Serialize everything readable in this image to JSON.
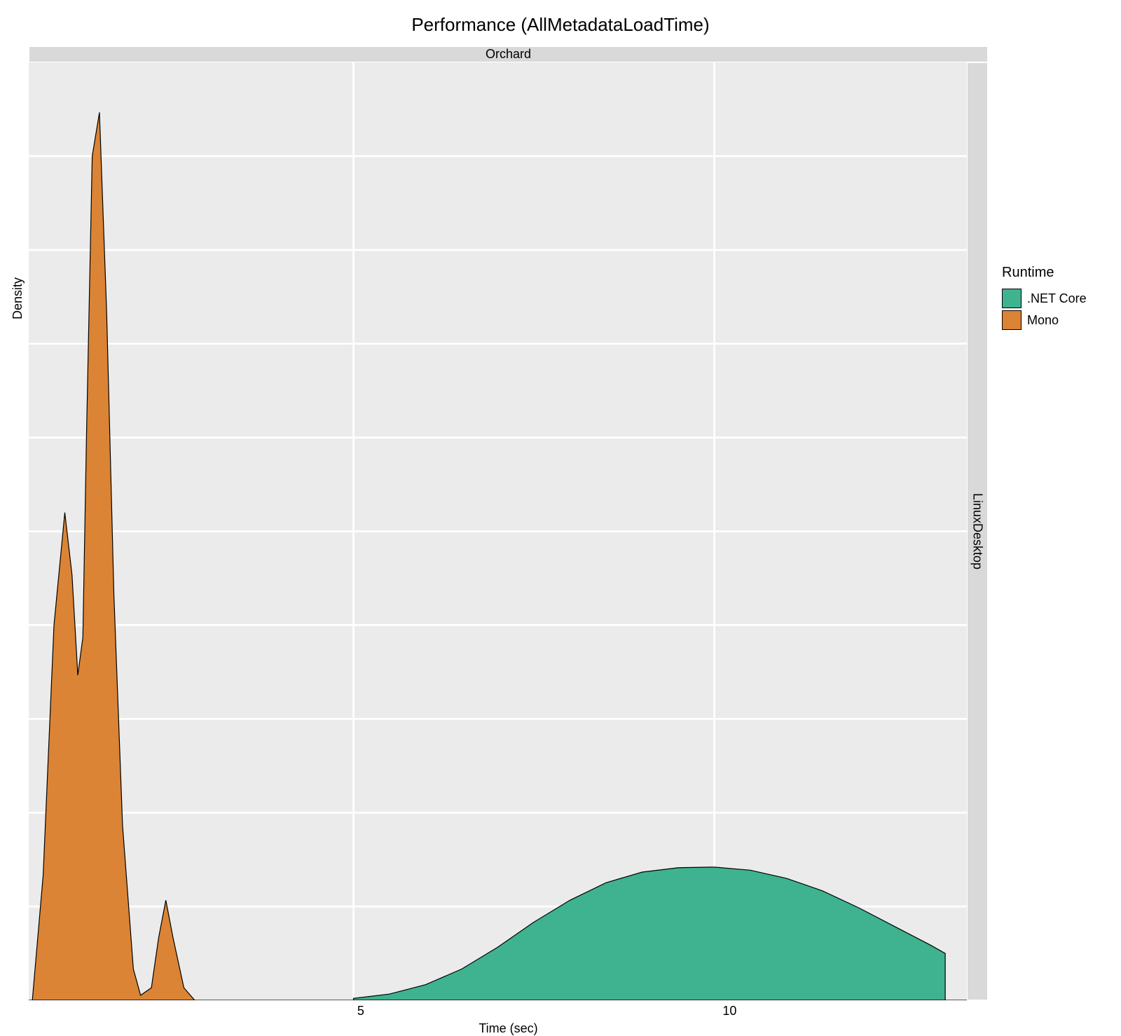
{
  "chart_data": {
    "type": "area",
    "title": "Performance (AllMetadataLoadTime)",
    "xlabel": "Time (sec)",
    "ylabel": "Density",
    "facet_col": "Orchard",
    "facet_row": "LinuxDesktop",
    "x_ticks": [
      5,
      10
    ],
    "x_range": [
      0.5,
      13.5
    ],
    "y_range": [
      0,
      1.5
    ],
    "legend_title": "Runtime",
    "series": [
      {
        "name": ".NET Core",
        "color": "#3fb28f",
        "x": [
          5.0,
          5.5,
          6.0,
          6.5,
          7.0,
          7.5,
          8.0,
          8.5,
          9.0,
          9.5,
          10.0,
          10.5,
          11.0,
          11.5,
          12.0,
          12.5,
          13.0,
          13.2
        ],
        "y": [
          0.003,
          0.01,
          0.025,
          0.05,
          0.085,
          0.125,
          0.16,
          0.188,
          0.205,
          0.212,
          0.213,
          0.208,
          0.195,
          0.175,
          0.148,
          0.118,
          0.088,
          0.075
        ]
      },
      {
        "name": "Mono",
        "color": "#db8435",
        "x": [
          0.55,
          0.7,
          0.85,
          1.0,
          1.1,
          1.18,
          1.25,
          1.3,
          1.38,
          1.48,
          1.58,
          1.68,
          1.8,
          1.95,
          2.05,
          2.2,
          2.3,
          2.4,
          2.5,
          2.65,
          2.8
        ],
        "y": [
          0.0,
          0.2,
          0.6,
          0.78,
          0.68,
          0.52,
          0.58,
          0.9,
          1.35,
          1.42,
          1.1,
          0.65,
          0.28,
          0.05,
          0.008,
          0.02,
          0.1,
          0.16,
          0.1,
          0.02,
          0.0
        ]
      }
    ]
  }
}
